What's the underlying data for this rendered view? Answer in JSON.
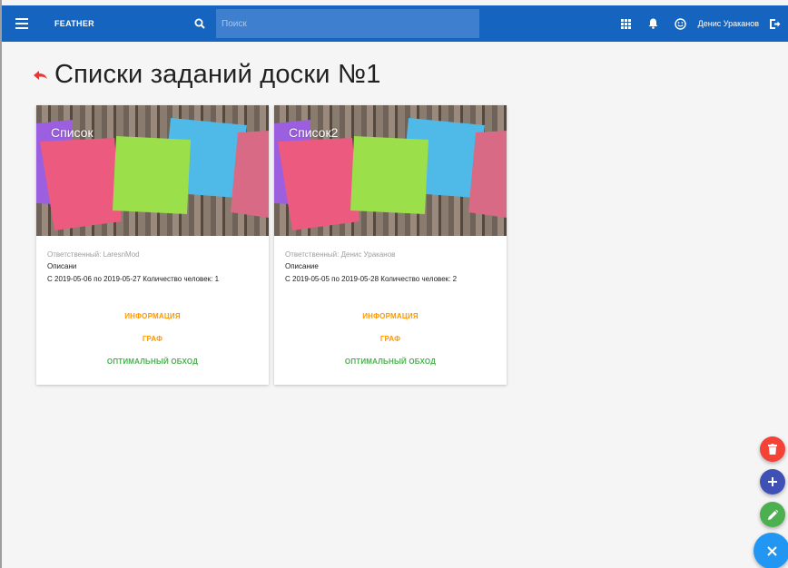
{
  "header": {
    "brand": "FEATHER",
    "search_placeholder": "Поиск",
    "user_name": "Денис Ураканов"
  },
  "page": {
    "title": "Списки заданий доски №1"
  },
  "cards": [
    {
      "title": "Список",
      "responsible": "Ответственный: LaresnMod",
      "description": "Описани",
      "dates": "С 2019-05-06 по 2019-05-27 Количество человек: 1",
      "actions": {
        "info": "Информация",
        "graph": "Граф",
        "optimal": "Оптимальный обход"
      }
    },
    {
      "title": "Список2",
      "responsible": "Ответственный: Денис Ураканов",
      "description": "Описание",
      "dates": "С 2019-05-05 по 2019-05-28 Количество человек: 2",
      "actions": {
        "info": "Информация",
        "graph": "Граф",
        "optimal": "Оптимальный обход"
      }
    }
  ],
  "colors": {
    "topbar": "#1565c0",
    "accent_orange": "#ff9800",
    "accent_green": "#4caf50",
    "fab_red": "#f44336",
    "fab_indigo": "#3f51b5",
    "fab_green": "#4caf50",
    "fab_blue": "#2196f3"
  },
  "icons": {
    "menu": "menu-icon",
    "search": "search-icon",
    "apps": "apps-grid-icon",
    "notifications": "bell-icon",
    "profile": "smiley-face-icon",
    "logout": "logout-icon",
    "back": "back-arrow-icon",
    "fab_delete": "trash-icon",
    "fab_add": "plus-icon",
    "fab_edit": "pencil-icon",
    "fab_close": "close-icon"
  }
}
